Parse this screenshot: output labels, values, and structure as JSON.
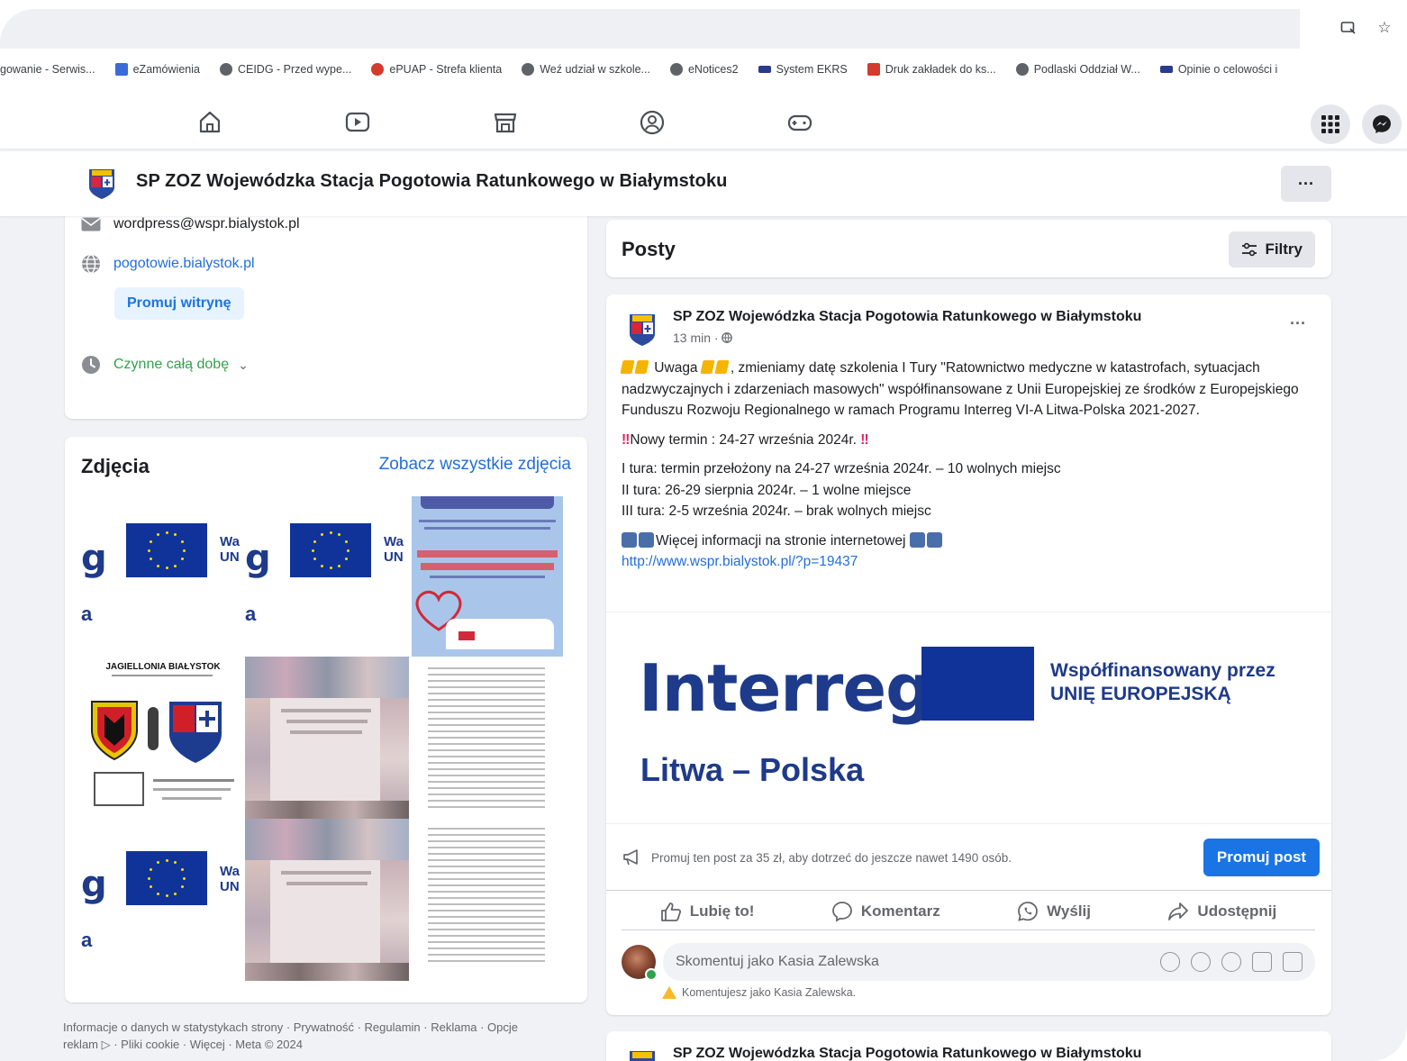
{
  "browser": {
    "bookmarks": [
      {
        "label": "gowanie - Serwis...",
        "icon": "generic"
      },
      {
        "label": "eZamówienia",
        "icon": "chart"
      },
      {
        "label": "CEIDG - Przed wype...",
        "icon": "globe"
      },
      {
        "label": "ePUAP - Strefa klienta",
        "icon": "flag"
      },
      {
        "label": "Weź udział w szkole...",
        "icon": "globe"
      },
      {
        "label": "eNotices2",
        "icon": "globe"
      },
      {
        "label": "System EKRS",
        "icon": "navy"
      },
      {
        "label": "Druk zakładek do ks...",
        "icon": "red"
      },
      {
        "label": "Podlaski Oddział W...",
        "icon": "globe"
      },
      {
        "label": "Opinie o celowości i",
        "icon": "red"
      }
    ]
  },
  "page": {
    "name": "SP ZOZ Wojewódzka Stacja Pogotowia Ratunkowego w Białymstoku",
    "more_label": "···"
  },
  "intro": {
    "email": "wordpress@wspr.bialystok.pl",
    "website": "pogotowie.bialystok.pl",
    "promote_site": "Promuj witrynę",
    "hours": "Czynne całą dobę",
    "hours_chevron": "⌄"
  },
  "photos": {
    "title": "Zdjęcia",
    "see_all": "Zobacz wszystkie zdjęcia",
    "thumb_header": "JAGIELLONIA BIAŁYSTOK"
  },
  "footer": {
    "line1": "Informacje o danych w statystykach strony · Prywatność · Regulamin · Reklama · Opcje",
    "line2": "reklam ▷ · Pliki cookie · Więcej · Meta © 2024"
  },
  "posts": {
    "title": "Posty",
    "filters_label": "Filtry"
  },
  "post": {
    "author": "SP ZOZ Wojewódzka Stacja Pogotowia Ratunkowego w Białymstoku",
    "time": "13 min · ",
    "body_lead": " Uwaga ",
    "body_main": ", zmieniamy datę szkolenia I Tury \"Ratownictwo medyczne w katastrofach, sytuacjach nadzwyczajnych i zdarzeniach masowych\" współfinansowane z Unii Europejskiej ze środków z Europejskiego Funduszu Rozwoju Regionalnego w ramach Programu Interreg VI-A Litwa-Polska 2021-2027.",
    "new_term": "Nowy termin : 24-27 września 2024r.",
    "turns": [
      "I tura: termin przełożony na 24-27 września 2024r. – 10 wolnych miejsc",
      "II tura: 26-29 sierpnia 2024r. – 1 wolne miejsce",
      "III tura: 2-5 września 2024r. – brak wolnych miejsc"
    ],
    "more_info": "Więcej informacji na stronie internetowej",
    "url": "http://www.wspr.bialystok.pl/?p=19437",
    "banner": {
      "brand": "Interreg",
      "region": "Litwa – Polska",
      "cofinanced_1": "Współfinansowany przez",
      "cofinanced_2": "UNIĘ EUROPEJSKĄ"
    },
    "promo_text": "Promuj ten post za 35 zł, aby dotrzeć do jeszcze nawet 1490 osób.",
    "promo_button": "Promuj post",
    "actions": {
      "like": "Lubię to!",
      "comment": "Komentarz",
      "send": "Wyślij",
      "share": "Udostępnij"
    },
    "comment_placeholder": "Skomentuj jako Kasia Zalewska",
    "comment_warning": "Komentujesz jako Kasia Zalewska."
  },
  "next_post": {
    "author": "SP ZOZ Wojewódzka Stacja Pogotowia Ratunkowego w Białymstoku"
  },
  "colors": {
    "fb_blue": "#1b74e4",
    "link": "#216fdb",
    "eu_blue": "#10339a",
    "interreg_navy": "#1e3a8a",
    "open_green": "#31a24c"
  }
}
